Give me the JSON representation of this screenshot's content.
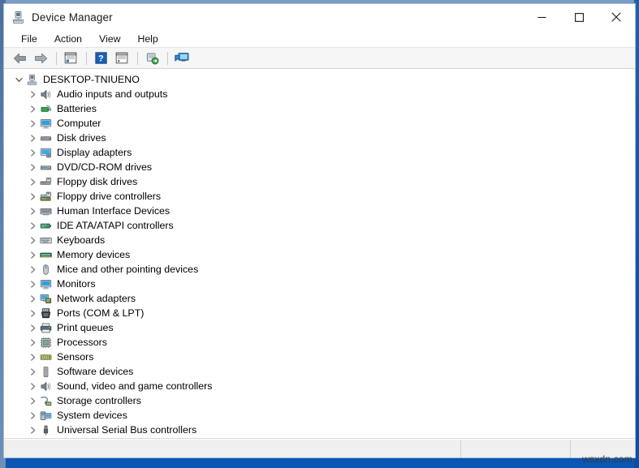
{
  "window": {
    "title": "Device Manager",
    "title_icon": "device-manager-icon",
    "controls": {
      "minimize": "─",
      "maximize": "☐",
      "close": "✕"
    }
  },
  "menu": {
    "items": [
      {
        "label": "File",
        "name": "menu-file"
      },
      {
        "label": "Action",
        "name": "menu-action"
      },
      {
        "label": "View",
        "name": "menu-view"
      },
      {
        "label": "Help",
        "name": "menu-help"
      }
    ]
  },
  "toolbar": {
    "buttons": [
      {
        "name": "back-button",
        "icon": "back-arrow-icon",
        "tooltip": "Back"
      },
      {
        "name": "forward-button",
        "icon": "forward-arrow-icon",
        "tooltip": "Forward"
      },
      {
        "name": "properties-button",
        "icon": "properties-icon",
        "tooltip": "Properties"
      },
      {
        "name": "help-button",
        "icon": "help-question-icon",
        "tooltip": "Help"
      },
      {
        "name": "show-hide-console-tree-button",
        "icon": "console-tree-icon",
        "tooltip": "Show/Hide console tree"
      },
      {
        "name": "scan-hardware-changes-button",
        "icon": "scan-hardware-icon",
        "tooltip": "Scan for hardware changes"
      },
      {
        "name": "update-driver-button",
        "icon": "update-driver-icon",
        "tooltip": "Update driver"
      }
    ]
  },
  "tree": {
    "root": {
      "label": "DESKTOP-TNIUENO",
      "icon": "computer-root-icon",
      "expanded": true,
      "twisty": "chevron-down-icon"
    },
    "children": [
      {
        "label": "Audio inputs and outputs",
        "icon": "speaker-icon",
        "name": "tree-item-audio-inputs-and-outputs"
      },
      {
        "label": "Batteries",
        "icon": "battery-icon",
        "name": "tree-item-batteries"
      },
      {
        "label": "Computer",
        "icon": "monitor-icon",
        "name": "tree-item-computer"
      },
      {
        "label": "Disk drives",
        "icon": "disk-drive-icon",
        "name": "tree-item-disk-drives"
      },
      {
        "label": "Display adapters",
        "icon": "display-adapter-icon",
        "name": "tree-item-display-adapters"
      },
      {
        "label": "DVD/CD-ROM drives",
        "icon": "optical-drive-icon",
        "name": "tree-item-dvd-cd-rom-drives"
      },
      {
        "label": "Floppy disk drives",
        "icon": "floppy-disk-icon",
        "name": "tree-item-floppy-disk-drives"
      },
      {
        "label": "Floppy drive controllers",
        "icon": "floppy-controller-icon",
        "name": "tree-item-floppy-drive-controllers"
      },
      {
        "label": "Human Interface Devices",
        "icon": "hid-icon",
        "name": "tree-item-human-interface-devices"
      },
      {
        "label": "IDE ATA/ATAPI controllers",
        "icon": "ide-controller-icon",
        "name": "tree-item-ide-ata-atapi-controllers"
      },
      {
        "label": "Keyboards",
        "icon": "keyboard-icon",
        "name": "tree-item-keyboards"
      },
      {
        "label": "Memory devices",
        "icon": "memory-icon",
        "name": "tree-item-memory-devices"
      },
      {
        "label": "Mice and other pointing devices",
        "icon": "mouse-icon",
        "name": "tree-item-mice-and-other-pointing-devices"
      },
      {
        "label": "Monitors",
        "icon": "monitor-icon",
        "name": "tree-item-monitors"
      },
      {
        "label": "Network adapters",
        "icon": "network-adapter-icon",
        "name": "tree-item-network-adapters"
      },
      {
        "label": "Ports (COM & LPT)",
        "icon": "port-icon",
        "name": "tree-item-ports-com-lpt"
      },
      {
        "label": "Print queues",
        "icon": "printer-icon",
        "name": "tree-item-print-queues"
      },
      {
        "label": "Processors",
        "icon": "processor-icon",
        "name": "tree-item-processors"
      },
      {
        "label": "Sensors",
        "icon": "sensor-icon",
        "name": "tree-item-sensors"
      },
      {
        "label": "Software devices",
        "icon": "software-device-icon",
        "name": "tree-item-software-devices"
      },
      {
        "label": "Sound, video and game controllers",
        "icon": "speaker-icon",
        "name": "tree-item-sound-video-and-game-controllers"
      },
      {
        "label": "Storage controllers",
        "icon": "storage-controller-icon",
        "name": "tree-item-storage-controllers"
      },
      {
        "label": "System devices",
        "icon": "system-device-icon",
        "name": "tree-item-system-devices"
      },
      {
        "label": "Universal Serial Bus controllers",
        "icon": "usb-icon",
        "name": "tree-item-universal-serial-bus-controllers"
      }
    ],
    "child_twisty": "chevron-right-icon"
  },
  "statusbar": {
    "main_text": "",
    "mid_text": "",
    "end_text": ""
  },
  "watermark": {
    "text": "wsxdn.com"
  },
  "colors": {
    "accent_blue": "#0a57b5",
    "window_bg": "#ffffff",
    "toolbar_bg": "#f6f6f6",
    "statusbar_bg": "#f0f0f0",
    "close_hover": "#e81123"
  }
}
